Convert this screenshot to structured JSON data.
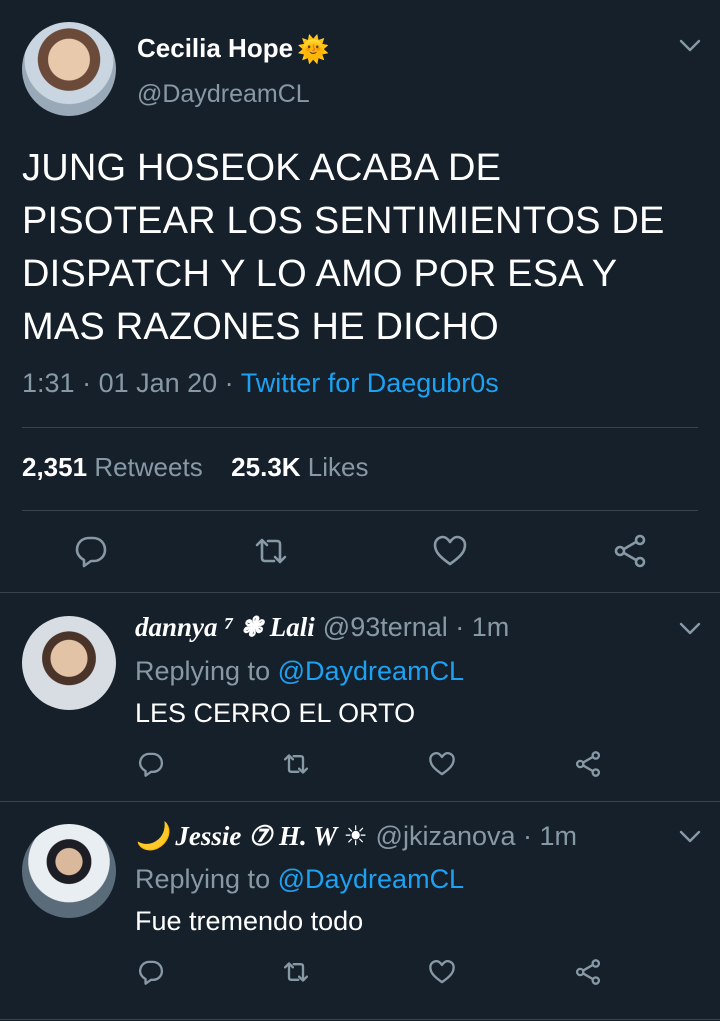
{
  "tweet": {
    "author_name": "Cecilia Hope",
    "author_emoji": "🌞",
    "handle": "@DaydreamCL",
    "text": "JUNG HOSEOK ACABA DE PISOTEAR LOS SENTIMIENTOS DE DISPATCH Y LO AMO POR ESA Y MAS RAZONES HE DICHO",
    "time": "1:31",
    "date": "01 Jan 20",
    "source": "Twitter for Daegubr0s",
    "retweets_count": "2,351",
    "retweets_label": "Retweets",
    "likes_count": "25.3K",
    "likes_label": "Likes"
  },
  "replies": [
    {
      "display_name": "dannya ⁷ ❃ Lali",
      "handle": "@93ternal",
      "time": "1m",
      "replying_label": "Replying to",
      "replying_to": "@DaydreamCL",
      "text": "LES CERRO EL ORTO"
    },
    {
      "display_name": "🌙 Jessie ⑦ H. W ☀",
      "handle": "@jkizanova",
      "time": "1m",
      "replying_label": "Replying to",
      "replying_to": "@DaydreamCL",
      "text": "Fue tremendo todo"
    }
  ],
  "icons": {
    "more": "chevron-down-icon",
    "reply": "reply-icon",
    "retweet": "retweet-icon",
    "like": "heart-icon",
    "share": "share-icon"
  },
  "colors": {
    "background": "#15202b",
    "text": "#ffffff",
    "muted": "#8899a6",
    "link": "#1da1f2",
    "divider": "#38444d"
  }
}
